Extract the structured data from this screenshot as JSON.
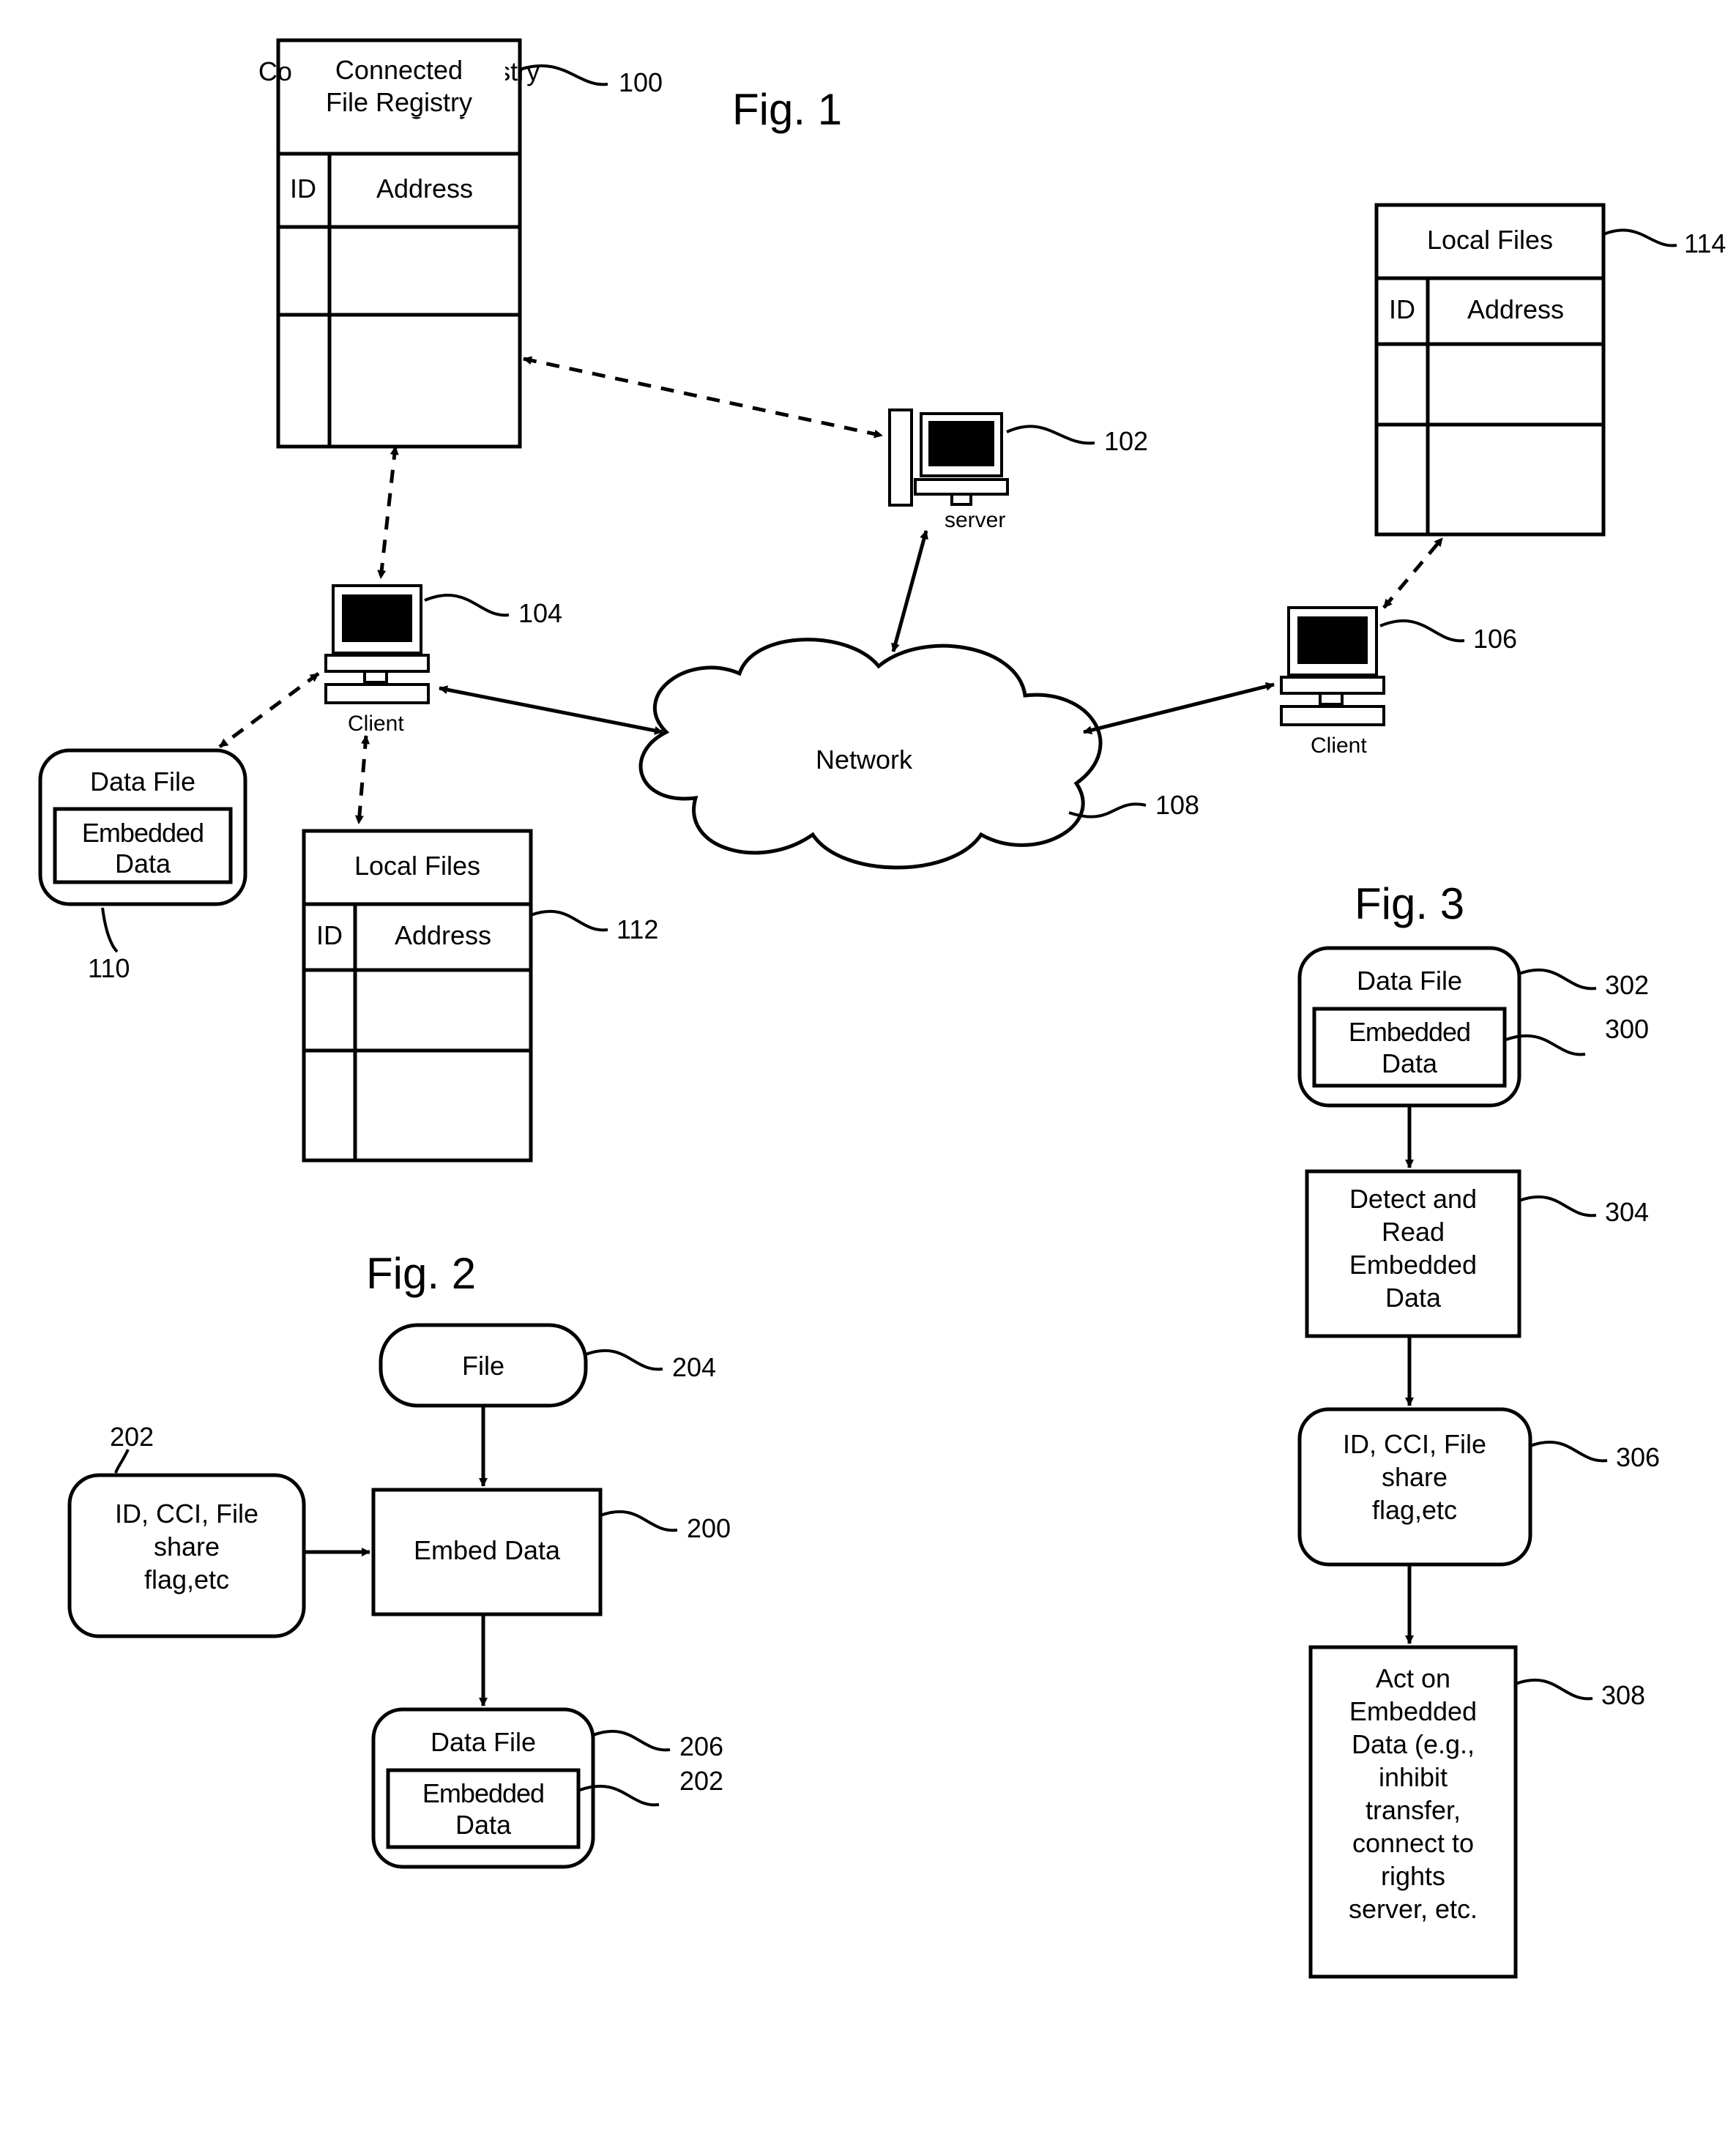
{
  "fig1": {
    "title": "Fig. 1",
    "registry": {
      "header": "Connected File Registry",
      "col1": "ID",
      "col2": "Address",
      "ref": "100"
    },
    "server": {
      "label": "server",
      "ref": "102"
    },
    "client": {
      "label": "Client",
      "ref": "104"
    },
    "client2": {
      "label": "Client",
      "ref": "106"
    },
    "network": {
      "label": "Network",
      "ref": "108"
    },
    "datafile": {
      "header": "Data File",
      "inner": "Embedded Data",
      "ref": "110"
    },
    "local1": {
      "header": "Local Files",
      "col1": "ID",
      "col2": "Address",
      "ref": "112"
    },
    "local2": {
      "header": "Local Files",
      "col1": "ID",
      "col2": "Address",
      "ref": "114"
    }
  },
  "fig2": {
    "title": "Fig. 2",
    "meta": {
      "text1": "ID, CCI, File",
      "text2": "share",
      "text3": "flag,etc",
      "ref": "202"
    },
    "file": {
      "label": "File",
      "ref": "204"
    },
    "embed": {
      "label": "Embed Data",
      "ref": "200"
    },
    "datafile": {
      "header": "Data File",
      "inner": "Embedded Data",
      "refOuter": "206",
      "refInner": "202"
    }
  },
  "fig3": {
    "title": "Fig. 3",
    "datafile": {
      "header": "Data File",
      "inner": "Embedded Data",
      "refOuter": "302",
      "refInner": "300"
    },
    "detect": {
      "l1": "Detect and",
      "l2": "Read",
      "l3": "Embedded",
      "l4": "Data",
      "ref": "304"
    },
    "meta": {
      "l1": "ID, CCI, File",
      "l2": "share",
      "l3": "flag,etc",
      "ref": "306"
    },
    "act": {
      "l1": "Act on",
      "l2": "Embedded",
      "l3": "Data (e.g.,",
      "l4": "inhibit",
      "l5": "transfer,",
      "l6": "connect to",
      "l7": "rights",
      "l8": "server, etc.",
      "ref": "308"
    }
  }
}
